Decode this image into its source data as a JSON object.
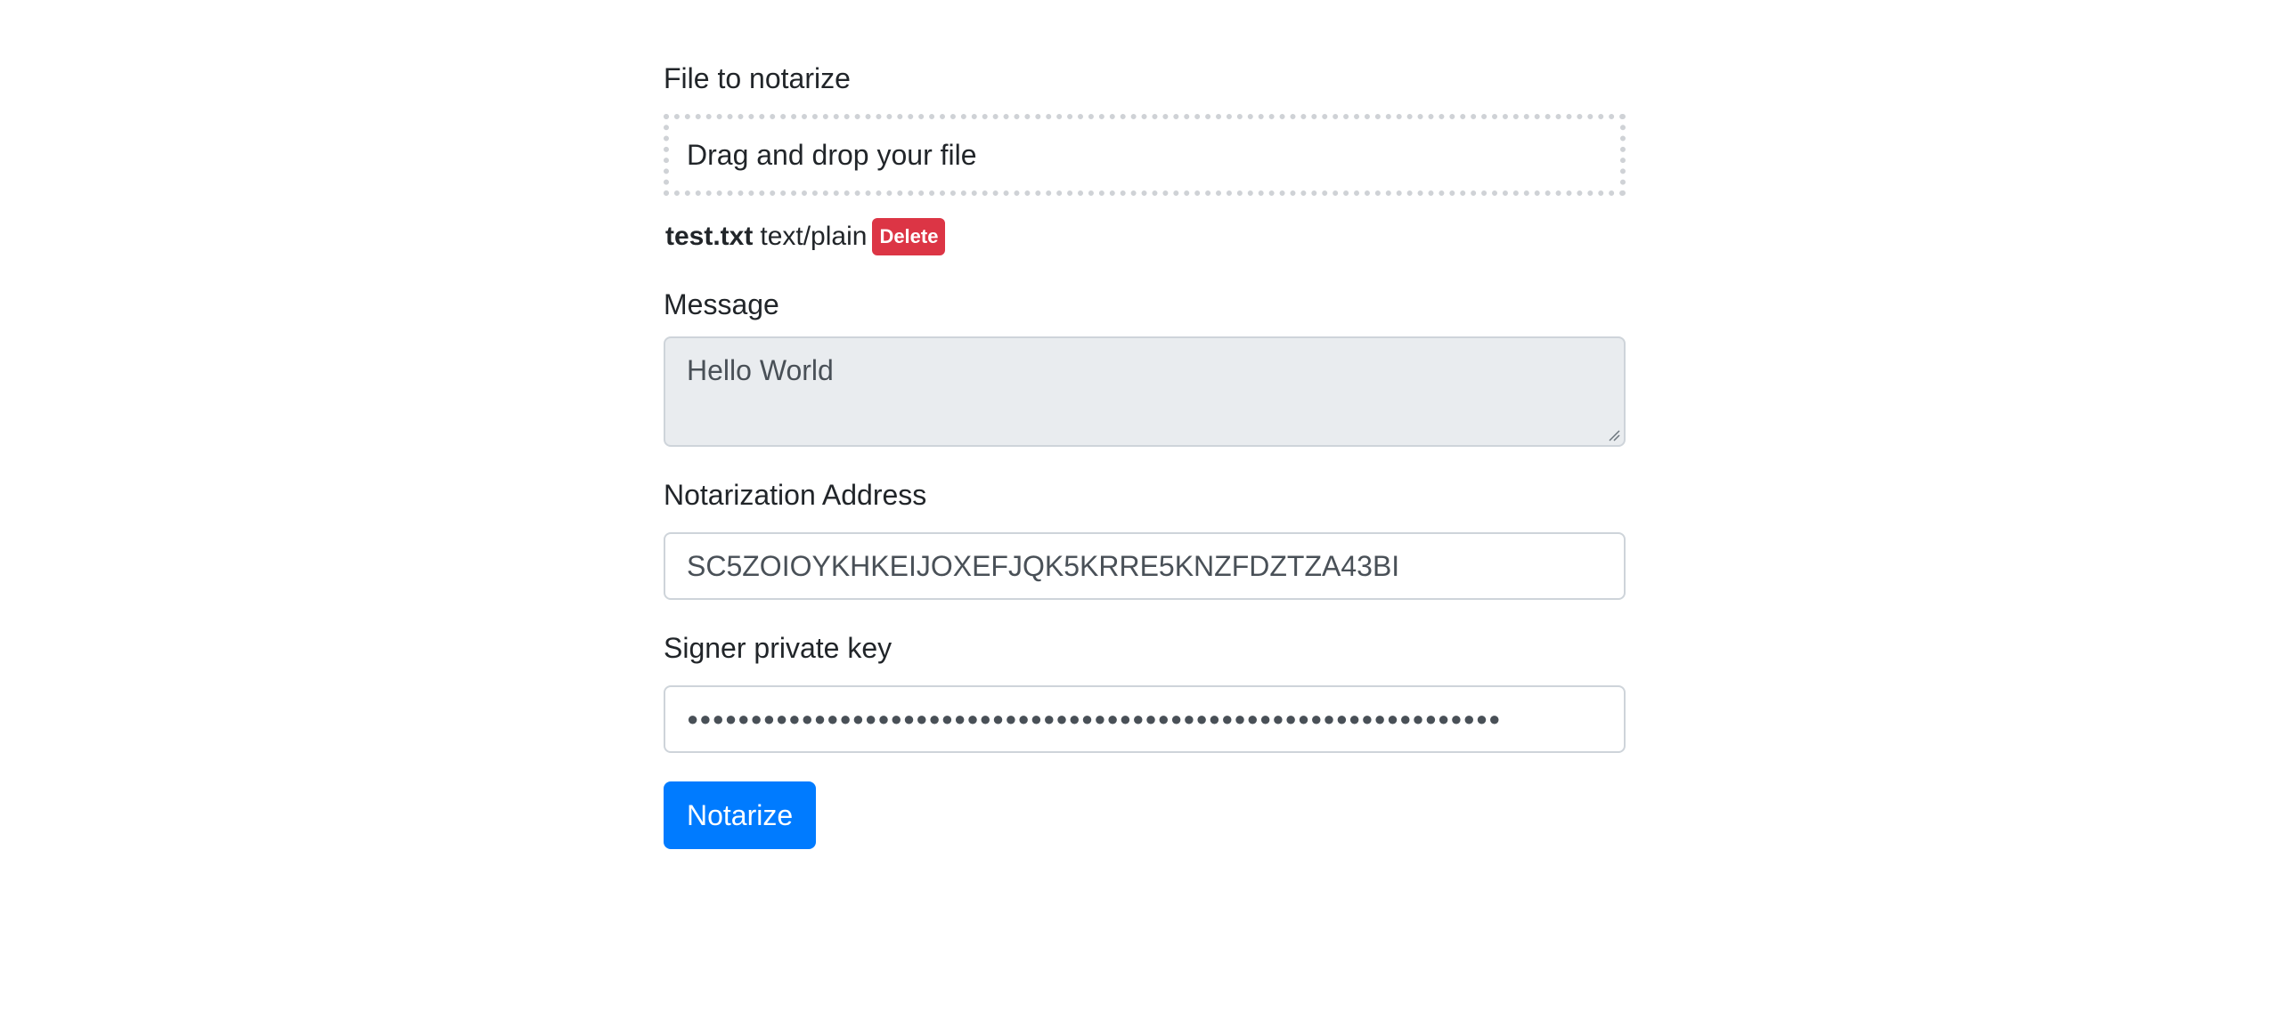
{
  "file_section": {
    "label": "File to notarize",
    "dropzone_text": "Drag and drop your file",
    "file": {
      "name": "test.txt",
      "type": "text/plain",
      "delete_label": "Delete"
    }
  },
  "message_section": {
    "label": "Message",
    "value": "Hello World"
  },
  "address_section": {
    "label": "Notarization Address",
    "value": "SC5ZOIOYKHKEIJOXEFJQK5KRRE5KNZFDZTZA43BI"
  },
  "key_section": {
    "label": "Signer private key",
    "masked_value": "●●●●●●●●●●●●●●●●●●●●●●●●●●●●●●●●●●●●●●●●●●●●●●●●●●●●●●●●●●●●●●●●"
  },
  "submit": {
    "label": "Notarize"
  },
  "colors": {
    "primary": "#007bff",
    "danger": "#dc3545",
    "disabled_bg": "#e9ecef"
  }
}
